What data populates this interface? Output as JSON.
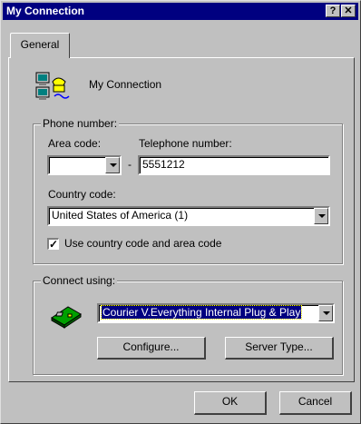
{
  "window": {
    "title": "My Connection"
  },
  "titlebar": {
    "help_glyph": "?",
    "close_glyph": "✕"
  },
  "tabs": [
    {
      "label": "General"
    }
  ],
  "connection": {
    "name": "My Connection",
    "icon": "dialup-computer-icon"
  },
  "phone": {
    "group_label": "Phone number:",
    "area_code_label": "Area code:",
    "area_code_value": "",
    "separator": "-",
    "telephone_label": "Telephone number:",
    "telephone_value": "5551212",
    "country_label": "Country code:",
    "country_value": "United States of America (1)",
    "use_codes_label": "Use country code and area code",
    "use_codes_checked": true
  },
  "connect_using": {
    "group_label": "Connect using:",
    "modem_icon": "modem-card-icon",
    "modem_value": "Courier V.Everything Internal Plug & Play",
    "configure_label": "Configure...",
    "server_type_label": "Server Type..."
  },
  "footer": {
    "ok_label": "OK",
    "cancel_label": "Cancel"
  },
  "colors": {
    "titlebar": "#000080",
    "face": "#c0c0c0",
    "selection": "#000080"
  }
}
